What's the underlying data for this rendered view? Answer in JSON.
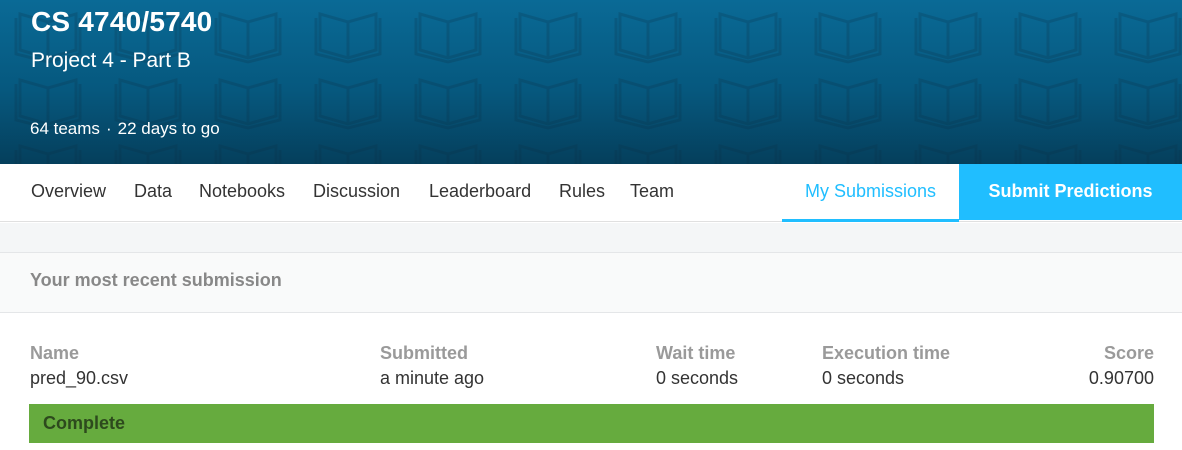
{
  "competition": {
    "title": "CS 4740/5740",
    "subtitle": "Project 4 - Part B",
    "teams": "64 teams",
    "separator": "·",
    "deadline": "22 days to go"
  },
  "nav": {
    "items": [
      "Overview",
      "Data",
      "Notebooks",
      "Discussion",
      "Leaderboard",
      "Rules",
      "Team"
    ],
    "my_submissions": "My Submissions",
    "submit_predictions": "Submit Predictions"
  },
  "submission": {
    "section_title": "Your most recent submission",
    "headers": {
      "name": "Name",
      "submitted": "Submitted",
      "wait_time": "Wait time",
      "execution_time": "Execution time",
      "score": "Score"
    },
    "values": {
      "name": "pred_90.csv",
      "submitted": "a minute ago",
      "wait_time": "0 seconds",
      "execution_time": "0 seconds",
      "score": "0.90700"
    },
    "status": "Complete"
  },
  "colors": {
    "banner": "#06587e",
    "accent": "#20beff",
    "status_complete": "#66ab3e"
  },
  "icons": {
    "banner_pattern": "open-book-icon"
  }
}
